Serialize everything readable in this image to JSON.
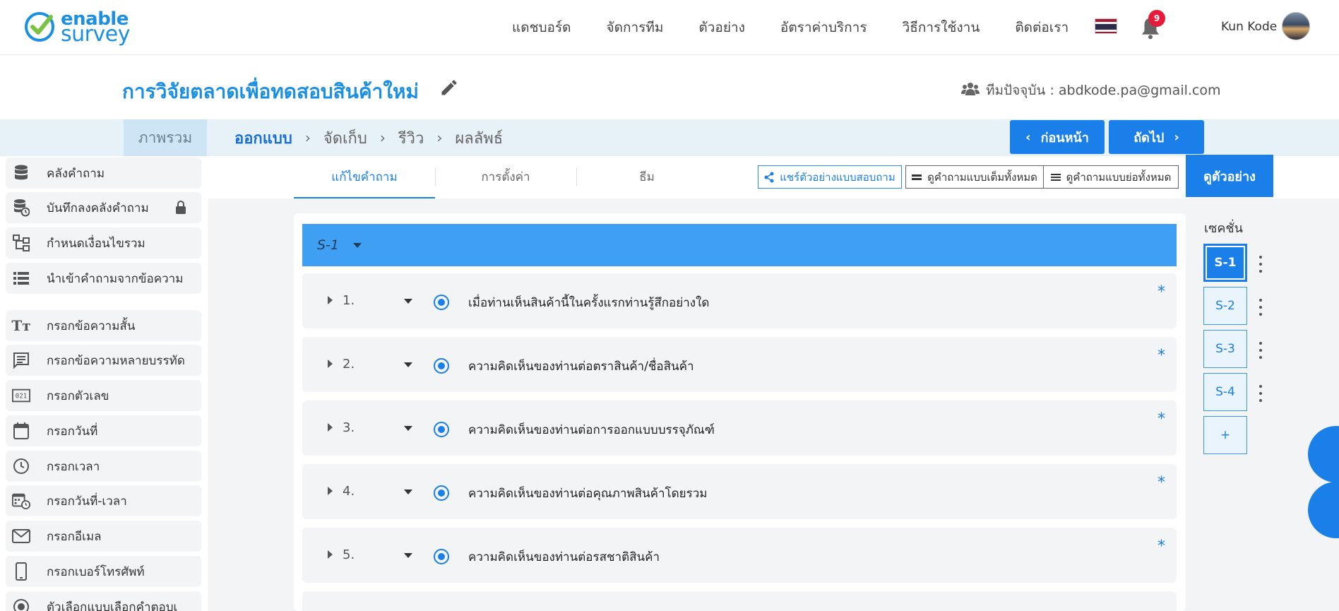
{
  "app": {
    "logo_line1": "enable",
    "logo_line2": "survey",
    "nav": [
      "แดชบอร์ด",
      "จัดการทีม",
      "ตัวอย่าง",
      "อัตราค่าบริการ",
      "วิธีการใช้งาน",
      "ติดต่อเรา"
    ],
    "notification_count": "9",
    "username": "Kun Kode"
  },
  "project": {
    "title": "การวิจัยตลาดเพื่อทดสอบสินค้าใหม่",
    "team_text": "ทีมปัจจุบัน : abdkode.pa@gmail.com"
  },
  "stepbar": {
    "overview": "ภาพรวม",
    "steps": [
      "ออกแบบ",
      "จัดเก็บ",
      "รีวิว",
      "ผลลัพธ์"
    ],
    "active_step": "ออกแบบ",
    "prev": "ก่อนหน้า",
    "next": "ถัดไป"
  },
  "sidebar": {
    "items": [
      {
        "label": "คลังคำถาม",
        "icon": "database-icon"
      },
      {
        "label": "บันทึกลงคลังคำถาม",
        "icon": "database-save-icon",
        "locked": true
      },
      {
        "label": "กำหนดเงื่อนไขรวม",
        "icon": "flowchart-icon"
      },
      {
        "label": "นำเข้าคำถามจากข้อความ",
        "icon": "list-icon"
      },
      {
        "label": "กรอกข้อความสั้น",
        "icon": "text-size-icon"
      },
      {
        "label": "กรอกข้อความหลายบรรทัด",
        "icon": "message-lines-icon"
      },
      {
        "label": "กรอกตัวเลข",
        "icon": "number-box-icon"
      },
      {
        "label": "กรอกวันที่",
        "icon": "calendar-icon"
      },
      {
        "label": "กรอกเวลา",
        "icon": "clock-icon"
      },
      {
        "label": "กรอกวันที่-เวลา",
        "icon": "calendar-clock-icon"
      },
      {
        "label": "กรอกอีเมล",
        "icon": "mail-icon"
      },
      {
        "label": "กรอกเบอร์โทรศัพท์",
        "icon": "phone-icon"
      },
      {
        "label": "ตัวเลือกแบบเลือกคำตอบเ",
        "icon": "radio-icon"
      }
    ]
  },
  "editor": {
    "tabs": [
      "แก้ไขคำถาม",
      "การตั้งค่า",
      "ธีม"
    ],
    "share_label": "แชร์ตัวอย่างแบบสอบถาม",
    "view_full_label": "ดูคำถามแบบเต็มทั้งหมด",
    "view_compact_label": "ดูคำถามแบบย่อทั้งหมด",
    "preview_label": "ดูตัวอย่าง",
    "section_name": "S-1",
    "questions": [
      {
        "num": "1.",
        "text": "เมื่อท่านเห็นสินค้านี้ในครั้งแรกท่านรู้สึกอย่างใด",
        "required": "*"
      },
      {
        "num": "2.",
        "text": "ความคิดเห็นของท่านต่อตราสินค้า/ชื่อสินค้า",
        "required": "*"
      },
      {
        "num": "3.",
        "text": "ความคิดเห็นของท่านต่อการออกแบบบรรจุภัณฑ์",
        "required": "*"
      },
      {
        "num": "4.",
        "text": "ความคิดเห็นของท่านต่อคุณภาพสินค้าโดยรวม",
        "required": "*"
      },
      {
        "num": "5.",
        "text": "ความคิดเห็นของท่านต่อรสชาติสินค้า",
        "required": "*"
      }
    ]
  },
  "sections_panel": {
    "title": "เซคชั่น",
    "sections": [
      "S-1",
      "S-2",
      "S-3",
      "S-4"
    ],
    "active": "S-1",
    "add_label": "+"
  },
  "colors": {
    "primary": "#1a7fe8",
    "section_header": "#3fa0f3",
    "badge": "#e61b3a"
  }
}
